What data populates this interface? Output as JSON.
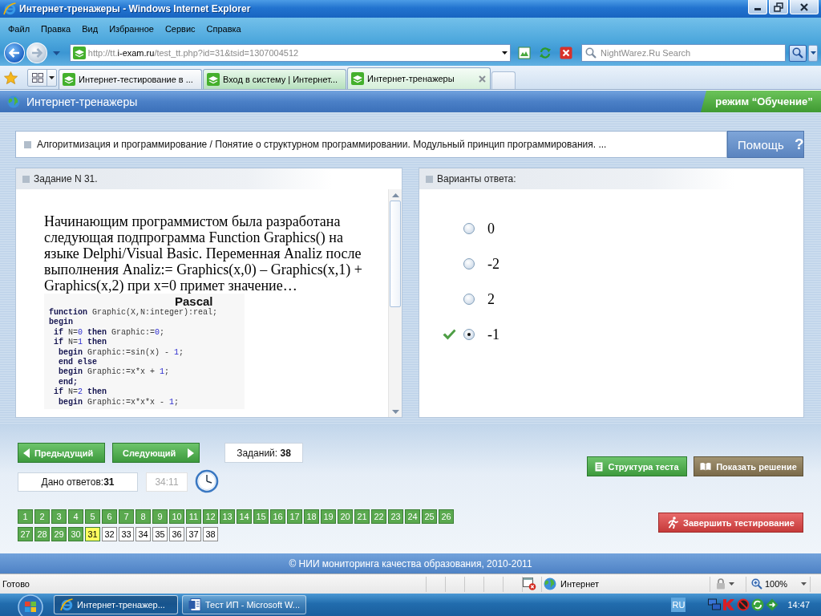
{
  "window": {
    "title": "Интернет-тренажеры - Windows Internet Explorer"
  },
  "menu": [
    "Файл",
    "Правка",
    "Вид",
    "Избранное",
    "Сервис",
    "Справка"
  ],
  "address_bar": {
    "url_prefix": "http://tt.",
    "url_domain": "i-exam.ru",
    "url_path": "/test_tt.php?id=31&tsid=1307004512"
  },
  "search": {
    "placeholder": "NightWarez.Ru Search"
  },
  "tabs": [
    {
      "label": "Интернет-тестирование в ...",
      "selected": false,
      "grouped": false
    },
    {
      "label": "Вход в систему | Интернет...",
      "selected": false,
      "grouped": true
    },
    {
      "label": "Интернет-тренажеры",
      "selected": true,
      "grouped": true
    }
  ],
  "page": {
    "header": {
      "title": "Интернет-тренажеры",
      "mode": "режим “Обучение”"
    },
    "breadcrumb": "Алгоритмизация и программирование / Понятие о структурном программировании. Модульный принцип программирования. ...",
    "help_button": {
      "label": "Помощь",
      "icon": "?"
    },
    "task": {
      "title": "Задание N 31.",
      "question": "Начинающим программистом была разработана следующая подпрограмма Function Graphics() на языке Delphi/Visual Basic. Переменная Analiz после выполнения Analiz:= Graphics(x,0) – Graphics(x,1) + Graphics(x,2) при x=0 примет значение…",
      "code": {
        "title": "Pascal",
        "lines": [
          [
            {
              "kind": "keyword",
              "text": "function"
            },
            {
              "kind": "text",
              "text": " Graphic(X,N:integer):real;"
            }
          ],
          [
            {
              "kind": "keyword",
              "text": "begin"
            }
          ],
          [
            {
              "kind": "keyword",
              "text": " if"
            },
            {
              "kind": "text",
              "text": " N="
            },
            {
              "kind": "number",
              "text": "0"
            },
            {
              "kind": "keyword",
              "text": " then"
            },
            {
              "kind": "text",
              "text": " Graphic:="
            },
            {
              "kind": "number",
              "text": "0"
            },
            {
              "kind": "text",
              "text": ";"
            }
          ],
          [
            {
              "kind": "keyword",
              "text": " if"
            },
            {
              "kind": "text",
              "text": " N="
            },
            {
              "kind": "number",
              "text": "1"
            },
            {
              "kind": "keyword",
              "text": " then"
            }
          ],
          [
            {
              "kind": "keyword",
              "text": "  begin"
            },
            {
              "kind": "text",
              "text": " Graphic:=sin(x) - "
            },
            {
              "kind": "number",
              "text": "1"
            },
            {
              "kind": "text",
              "text": ";"
            }
          ],
          [
            {
              "kind": "keyword",
              "text": "  end else"
            }
          ],
          [
            {
              "kind": "keyword",
              "text": "  begin"
            },
            {
              "kind": "text",
              "text": " Graphic:=x*x + "
            },
            {
              "kind": "number",
              "text": "1"
            },
            {
              "kind": "text",
              "text": ";"
            }
          ],
          [
            {
              "kind": "keyword",
              "text": "  end;"
            }
          ],
          [
            {
              "kind": "keyword",
              "text": " if"
            },
            {
              "kind": "text",
              "text": " N="
            },
            {
              "kind": "number",
              "text": "2"
            },
            {
              "kind": "keyword",
              "text": " then"
            }
          ],
          [
            {
              "kind": "keyword",
              "text": "  begin"
            },
            {
              "kind": "text",
              "text": " Graphic:=x*x*x - "
            },
            {
              "kind": "number",
              "text": "1"
            },
            {
              "kind": "text",
              "text": ";"
            }
          ]
        ]
      }
    },
    "answers": {
      "title": "Варианты ответа:",
      "options": [
        {
          "label": "0",
          "selected": false,
          "correct": false
        },
        {
          "label": "-2",
          "selected": false,
          "correct": false
        },
        {
          "label": "2",
          "selected": false,
          "correct": false
        },
        {
          "label": "-1",
          "selected": true,
          "correct": true
        }
      ]
    },
    "navigation": {
      "previous": "Предыдущий",
      "next": "Следующий",
      "tasks_total": "Заданий: **38**",
      "answered": "Дано ответов:**31**",
      "timer": "34:11"
    },
    "actions": {
      "structure": "Структура теста",
      "solution": "Показать решение",
      "finish": "Завершить тестирование"
    },
    "task_numbers": [
      {
        "label": "1",
        "answered": true,
        "selected": false
      },
      {
        "label": "2",
        "answered": true,
        "selected": false
      },
      {
        "label": "3",
        "answered": true,
        "selected": false
      },
      {
        "label": "4",
        "answered": true,
        "selected": false
      },
      {
        "label": "5",
        "answered": true,
        "selected": false
      },
      {
        "label": "6",
        "answered": true,
        "selected": false
      },
      {
        "label": "7",
        "answered": true,
        "selected": false
      },
      {
        "label": "8",
        "answered": true,
        "selected": false
      },
      {
        "label": "9",
        "answered": true,
        "selected": false
      },
      {
        "label": "10",
        "answered": true,
        "selected": false
      },
      {
        "label": "11",
        "answered": true,
        "selected": false
      },
      {
        "label": "12",
        "answered": true,
        "selected": false
      },
      {
        "label": "13",
        "answered": true,
        "selected": false
      },
      {
        "label": "14",
        "answered": true,
        "selected": false
      },
      {
        "label": "15",
        "answered": true,
        "selected": false
      },
      {
        "label": "16",
        "answered": true,
        "selected": false
      },
      {
        "label": "17",
        "answered": true,
        "selected": false
      },
      {
        "label": "18",
        "answered": true,
        "selected": false
      },
      {
        "label": "19",
        "answered": true,
        "selected": false
      },
      {
        "label": "20",
        "answered": true,
        "selected": false
      },
      {
        "label": "21",
        "answered": true,
        "selected": false
      },
      {
        "label": "22",
        "answered": true,
        "selected": false
      },
      {
        "label": "23",
        "answered": true,
        "selected": false
      },
      {
        "label": "24",
        "answered": true,
        "selected": false
      },
      {
        "label": "25",
        "answered": true,
        "selected": false
      },
      {
        "label": "26",
        "answered": true,
        "selected": false
      },
      {
        "label": "27",
        "answered": true,
        "selected": false
      },
      {
        "label": "28",
        "answered": true,
        "selected": false
      },
      {
        "label": "29",
        "answered": true,
        "selected": false
      },
      {
        "label": "30",
        "answered": true,
        "selected": false
      },
      {
        "label": "31",
        "answered": true,
        "selected": true
      },
      {
        "label": "32",
        "answered": false,
        "selected": false
      },
      {
        "label": "33",
        "answered": false,
        "selected": false
      },
      {
        "label": "34",
        "answered": false,
        "selected": false
      },
      {
        "label": "35",
        "answered": false,
        "selected": false
      },
      {
        "label": "36",
        "answered": false,
        "selected": false
      },
      {
        "label": "37",
        "answered": false,
        "selected": false
      },
      {
        "label": "38",
        "answered": false,
        "selected": false
      }
    ],
    "footer": "© НИИ мониторинга качества образования, 2010-2011"
  },
  "status_bar": {
    "text": "Готово",
    "zone": "Интернет",
    "zoom": "100%"
  },
  "taskbar": {
    "buttons": [
      {
        "label": "Интернет-тренажер...",
        "kind": "browser",
        "selected": true
      },
      {
        "label": "Тест ИП - Microsoft W...",
        "kind": "document",
        "selected": false
      }
    ],
    "language": "RU",
    "clock": "14:47"
  }
}
